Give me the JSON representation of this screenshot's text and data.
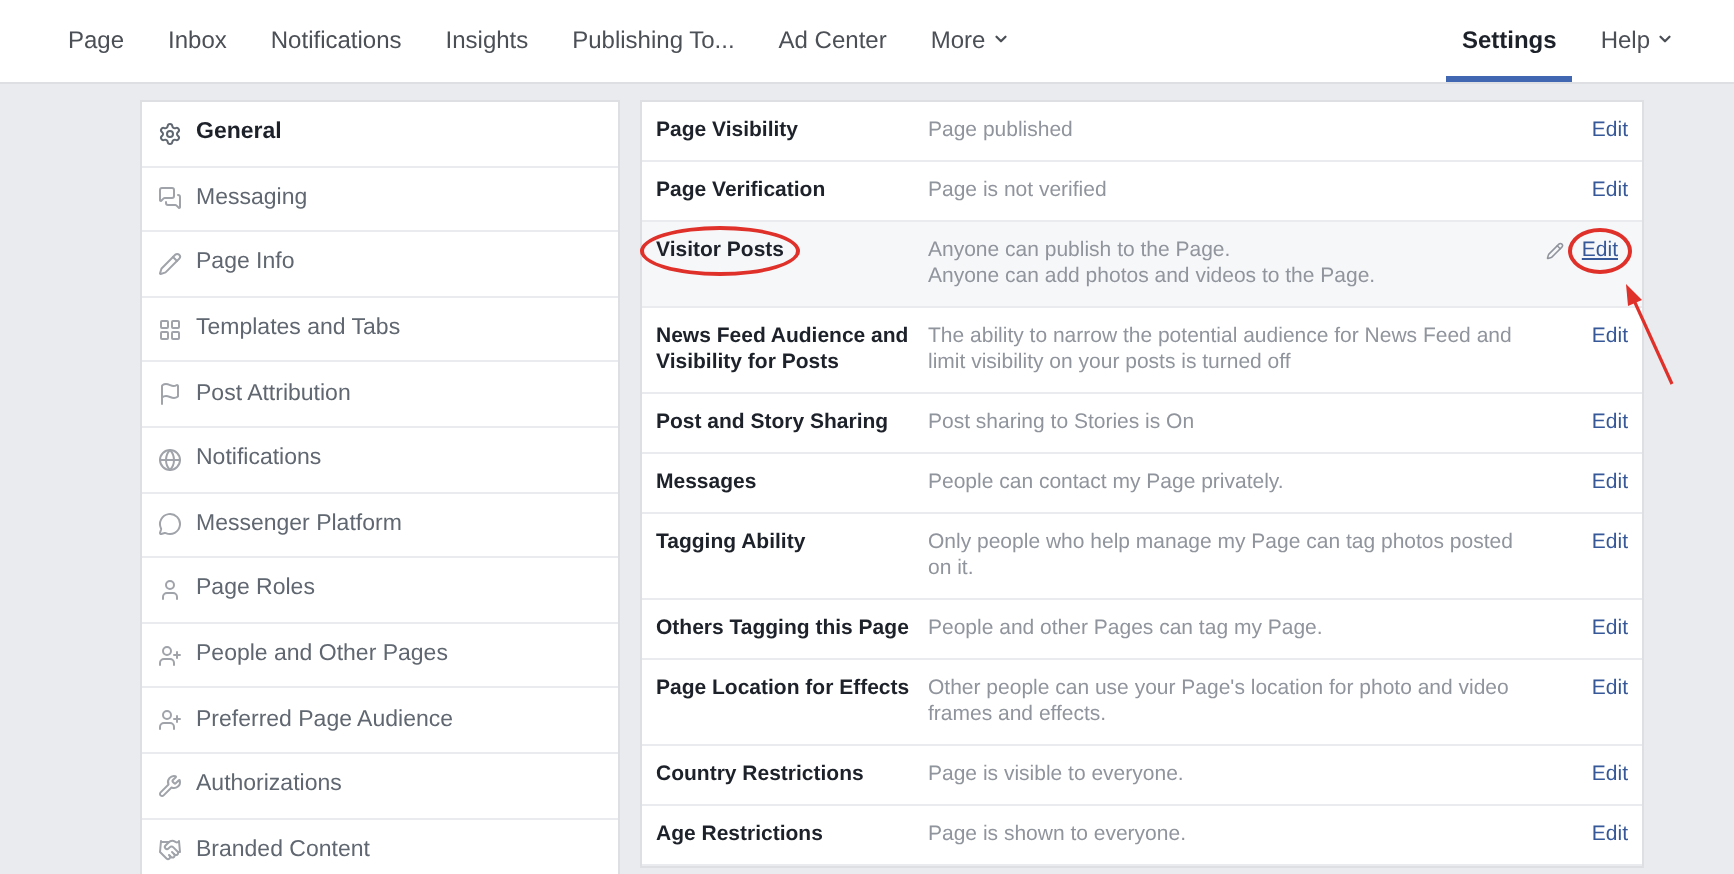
{
  "nav": {
    "items": [
      {
        "label": "Page",
        "selected": false,
        "dropdown": false
      },
      {
        "label": "Inbox",
        "selected": false,
        "dropdown": false
      },
      {
        "label": "Notifications",
        "selected": false,
        "dropdown": false
      },
      {
        "label": "Insights",
        "selected": false,
        "dropdown": false
      },
      {
        "label": "Publishing To...",
        "selected": false,
        "dropdown": false
      },
      {
        "label": "Ad Center",
        "selected": false,
        "dropdown": false
      },
      {
        "label": "More",
        "selected": false,
        "dropdown": true
      }
    ],
    "right_items": [
      {
        "label": "Settings",
        "selected": true,
        "dropdown": false
      },
      {
        "label": "Help",
        "selected": false,
        "dropdown": true
      }
    ]
  },
  "sidebar": {
    "items": [
      {
        "label": "General",
        "selected": true
      },
      {
        "label": "Messaging",
        "selected": false
      },
      {
        "label": "Page Info",
        "selected": false
      },
      {
        "label": "Templates and Tabs",
        "selected": false
      },
      {
        "label": "Post Attribution",
        "selected": false
      },
      {
        "label": "Notifications",
        "selected": false
      },
      {
        "label": "Messenger Platform",
        "selected": false
      },
      {
        "label": "Page Roles",
        "selected": false
      },
      {
        "label": "People and Other Pages",
        "selected": false
      },
      {
        "label": "Preferred Page Audience",
        "selected": false
      },
      {
        "label": "Authorizations",
        "selected": false
      },
      {
        "label": "Branded Content",
        "selected": false
      }
    ]
  },
  "settings": {
    "rows": [
      {
        "label": "Page Visibility",
        "description": [
          "Page published"
        ],
        "action": "Edit",
        "highlighted": false,
        "circled": false
      },
      {
        "label": "Page Verification",
        "description": [
          "Page is not verified"
        ],
        "action": "Edit",
        "highlighted": false,
        "circled": false
      },
      {
        "label": "Visitor Posts",
        "description": [
          "Anyone can publish to the Page.",
          "Anyone can add photos and videos to the Page."
        ],
        "action": "Edit",
        "highlighted": true,
        "circled": true
      },
      {
        "label": "News Feed Audience and Visibility for Posts",
        "description": [
          "The ability to narrow the potential audience for News Feed and limit visibility on your posts is turned off"
        ],
        "action": "Edit",
        "highlighted": false,
        "circled": false
      },
      {
        "label": "Post and Story Sharing",
        "description": [
          "Post sharing to Stories is On"
        ],
        "action": "Edit",
        "highlighted": false,
        "circled": false
      },
      {
        "label": "Messages",
        "description": [
          "People can contact my Page privately."
        ],
        "action": "Edit",
        "highlighted": false,
        "circled": false
      },
      {
        "label": "Tagging Ability",
        "description": [
          "Only people who help manage my Page can tag photos posted on it."
        ],
        "action": "Edit",
        "highlighted": false,
        "circled": false
      },
      {
        "label": "Others Tagging this Page",
        "description": [
          "People and other Pages can tag my Page."
        ],
        "action": "Edit",
        "highlighted": false,
        "circled": false
      },
      {
        "label": "Page Location for Effects",
        "description": [
          "Other people can use your Page's location for photo and video frames and effects."
        ],
        "action": "Edit",
        "highlighted": false,
        "circled": false
      },
      {
        "label": "Country Restrictions",
        "description": [
          "Page is visible to everyone."
        ],
        "action": "Edit",
        "highlighted": false,
        "circled": false
      },
      {
        "label": "Age Restrictions",
        "description": [
          "Page is shown to everyone."
        ],
        "action": "Edit",
        "highlighted": false,
        "circled": false
      }
    ]
  }
}
